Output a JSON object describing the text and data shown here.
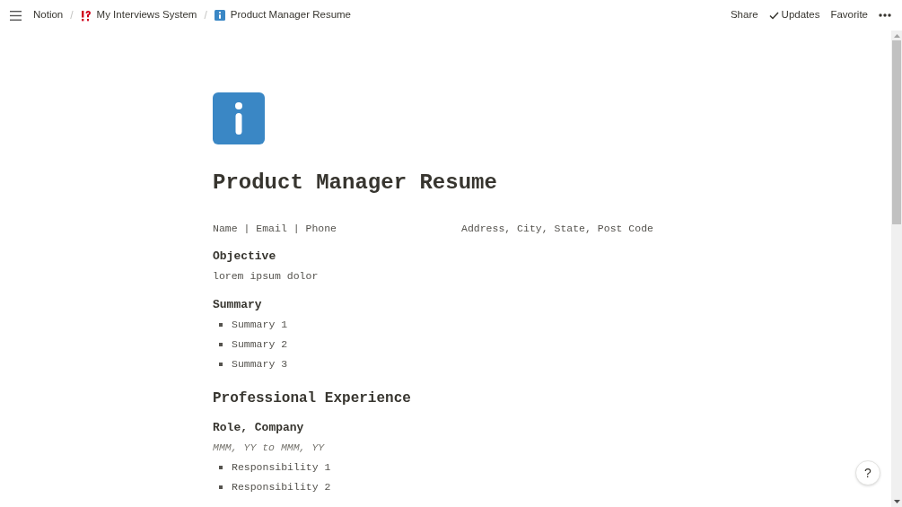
{
  "breadcrumbs": [
    {
      "label": "Notion"
    },
    {
      "separator": "/",
      "label": "My Interviews System"
    },
    {
      "separator": "/",
      "label": "Product Manager Resume"
    }
  ],
  "actions": [
    {
      "label": "Share"
    },
    {
      "label": "Updates"
    },
    {
      "label": "Favorite"
    }
  ],
  "page": {
    "title": "Product Manager Resume",
    "contact": {
      "left": "Name | Email | Phone",
      "right": "Address, City, State, Post Code"
    },
    "blocks": [
      {
        "kind": "heading",
        "text": "Objective"
      },
      {
        "kind": "text",
        "text": "lorem ipsum dolor"
      },
      {
        "kind": "heading",
        "text": "Summary"
      },
      {
        "kind": "bullet",
        "text": "Summary 1"
      },
      {
        "kind": "bullet",
        "text": "Summary 2"
      },
      {
        "kind": "bullet",
        "text": "Summary 3"
      },
      {
        "kind": "section",
        "text": "Professional Experience"
      },
      {
        "kind": "heading",
        "text": "Role, Company"
      },
      {
        "kind": "date",
        "text": "MMM, YY to MMM, YY"
      },
      {
        "kind": "bullet",
        "text": "Responsibility 1"
      },
      {
        "kind": "bullet",
        "text": "Responsibility 2"
      }
    ]
  },
  "help": "?"
}
